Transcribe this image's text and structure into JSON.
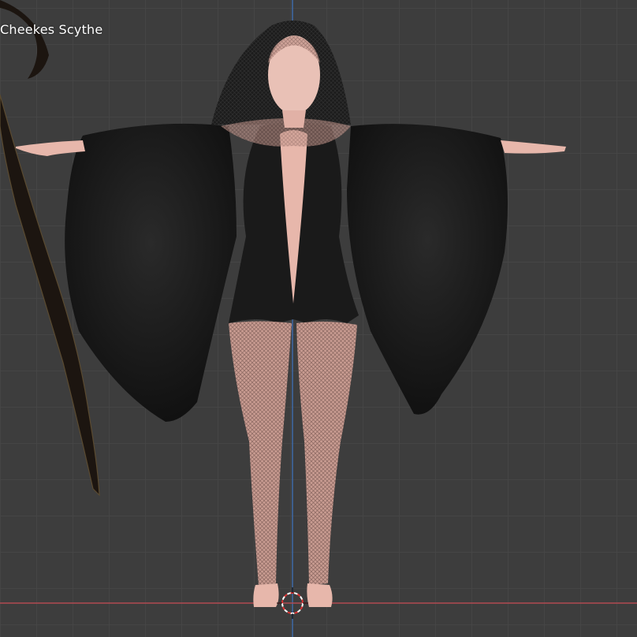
{
  "viewport": {
    "active_object_label": "Cheekes Scythe"
  },
  "colors": {
    "background": "#3d3d3d",
    "grid_line": "#464646",
    "x_axis": "#b24a52",
    "z_axis": "#3f6aa6",
    "cloth": "#1a1a1a",
    "skin": "#e7b7ab",
    "scythe": "#1c1510"
  },
  "icons": {
    "cursor": "3d-cursor-icon"
  }
}
